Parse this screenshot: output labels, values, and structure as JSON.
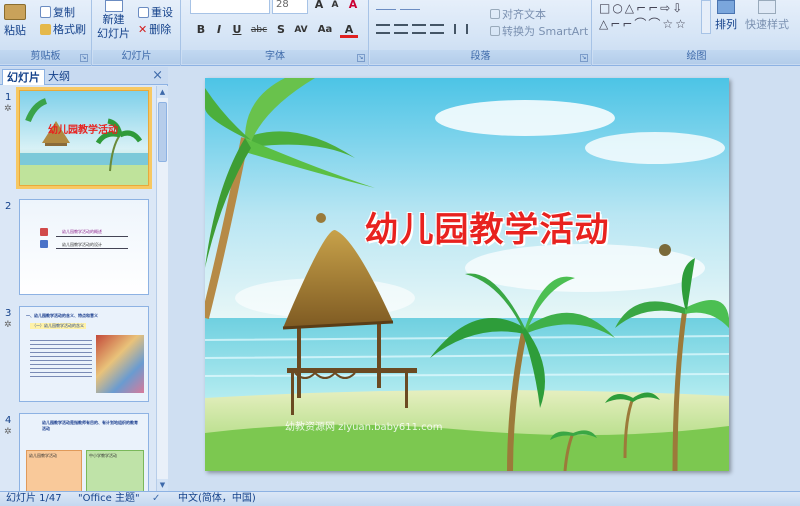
{
  "ribbon": {
    "clipboard": {
      "paste": "粘贴",
      "copy": "复制",
      "format_painter": "格式刷",
      "label": "剪贴板"
    },
    "slides": {
      "new_slide": "新建",
      "new_slide_line2": "幻灯片",
      "reset": "重设",
      "delete": "删除",
      "label": "幻灯片"
    },
    "font": {
      "size": "28",
      "bold": "B",
      "italic": "I",
      "underline": "U",
      "strike": "abc",
      "shadow": "S",
      "spacing": "AV",
      "case": "Aa",
      "grow": "A",
      "shrink": "A",
      "clear": "A",
      "label": "字体"
    },
    "paragraph": {
      "align_text": "对齐文本",
      "convert_smartart": "转换为 SmartArt",
      "label": "段落"
    },
    "drawing": {
      "arrange": "排列",
      "quick_styles": "快速样式",
      "label": "绘图"
    }
  },
  "panel": {
    "tab_slides": "幻灯片",
    "tab_outline": "大纲",
    "close": "×",
    "thumbs": [
      {
        "num": "1",
        "title": "幼儿园教学活动"
      },
      {
        "num": "2",
        "line1": "幼儿园教学活动的概述",
        "line2": "幼儿园教学活动的设计"
      },
      {
        "num": "3",
        "head": "一、幼儿园教学活动的含义、特点和意义",
        "sub": "（一）幼儿园教学活动的含义"
      },
      {
        "num": "4",
        "head": "幼儿园教学活动是指教师有目的、有计划地组织的教育活动",
        "box1": "幼儿园教学活动",
        "box2": "中小学教学活动"
      }
    ]
  },
  "slide": {
    "title": "幼儿园教学活动",
    "watermark": "幼教资源网 ziyuan.baby611.com"
  },
  "status": {
    "slide_counter": "幻灯片 1/47",
    "theme": "\"Office 主题\"",
    "language": "中文(简体，中国)"
  }
}
